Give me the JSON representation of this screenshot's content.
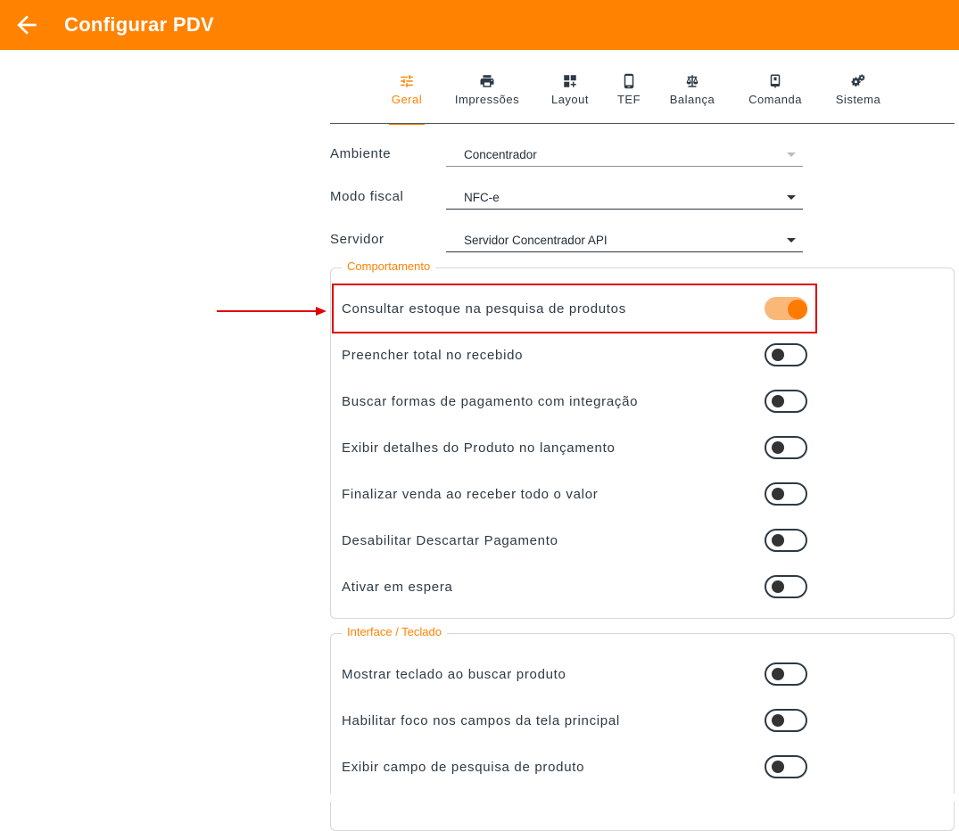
{
  "appbar": {
    "title": "Configurar PDV"
  },
  "tabs": [
    {
      "label": "Geral",
      "icon": "sliders-icon",
      "active": true
    },
    {
      "label": "Impressões",
      "icon": "printer-icon"
    },
    {
      "label": "Layout",
      "icon": "dashboard-add-icon"
    },
    {
      "label": "TEF",
      "icon": "phone-icon"
    },
    {
      "label": "Balança",
      "icon": "scale-icon"
    },
    {
      "label": "Comanda",
      "icon": "tablet-pen-icon"
    },
    {
      "label": "Sistema",
      "icon": "gears-icon"
    }
  ],
  "form": {
    "ambiente": {
      "label": "Ambiente",
      "value": "Concentrador"
    },
    "modo_fiscal": {
      "label": "Modo fiscal",
      "value": "NFC-e"
    },
    "servidor": {
      "label": "Servidor",
      "value": "Servidor Concentrador API"
    }
  },
  "groups": {
    "comportamento": {
      "legend": "Comportamento",
      "items": [
        {
          "label": "Consultar estoque na pesquisa de produtos",
          "on": true
        },
        {
          "label": "Preencher total no recebido",
          "on": false
        },
        {
          "label": "Buscar formas de pagamento com integração",
          "on": false
        },
        {
          "label": "Exibir detalhes do Produto no lançamento",
          "on": false
        },
        {
          "label": "Finalizar venda ao receber todo o valor",
          "on": false
        },
        {
          "label": "Desabilitar Descartar Pagamento",
          "on": false
        },
        {
          "label": "Ativar em espera",
          "on": false
        }
      ]
    },
    "interface": {
      "legend": "Interface / Teclado",
      "items": [
        {
          "label": "Mostrar teclado ao buscar produto",
          "on": false
        },
        {
          "label": "Habilitar foco nos campos da tela principal",
          "on": false
        },
        {
          "label": "Exibir campo de pesquisa de produto",
          "on": false
        }
      ]
    }
  },
  "colors": {
    "accent": "#ff8200",
    "annotation": "#e00000",
    "text": "#2d3a45"
  }
}
